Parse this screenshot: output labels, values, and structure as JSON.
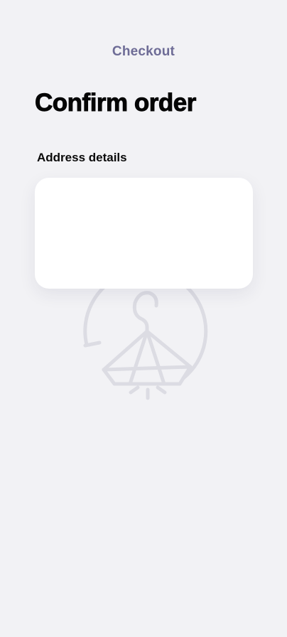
{
  "header": {
    "title": "Checkout"
  },
  "page": {
    "title": "Confirm order"
  },
  "address": {
    "section_title": "Address details"
  },
  "watermark": {
    "icon": "hanger-diamond-icon"
  },
  "colors": {
    "background": "#f2f2f5",
    "header_title": "#6e6c96",
    "card": "#ffffff",
    "watermark": "#dcdce3"
  }
}
